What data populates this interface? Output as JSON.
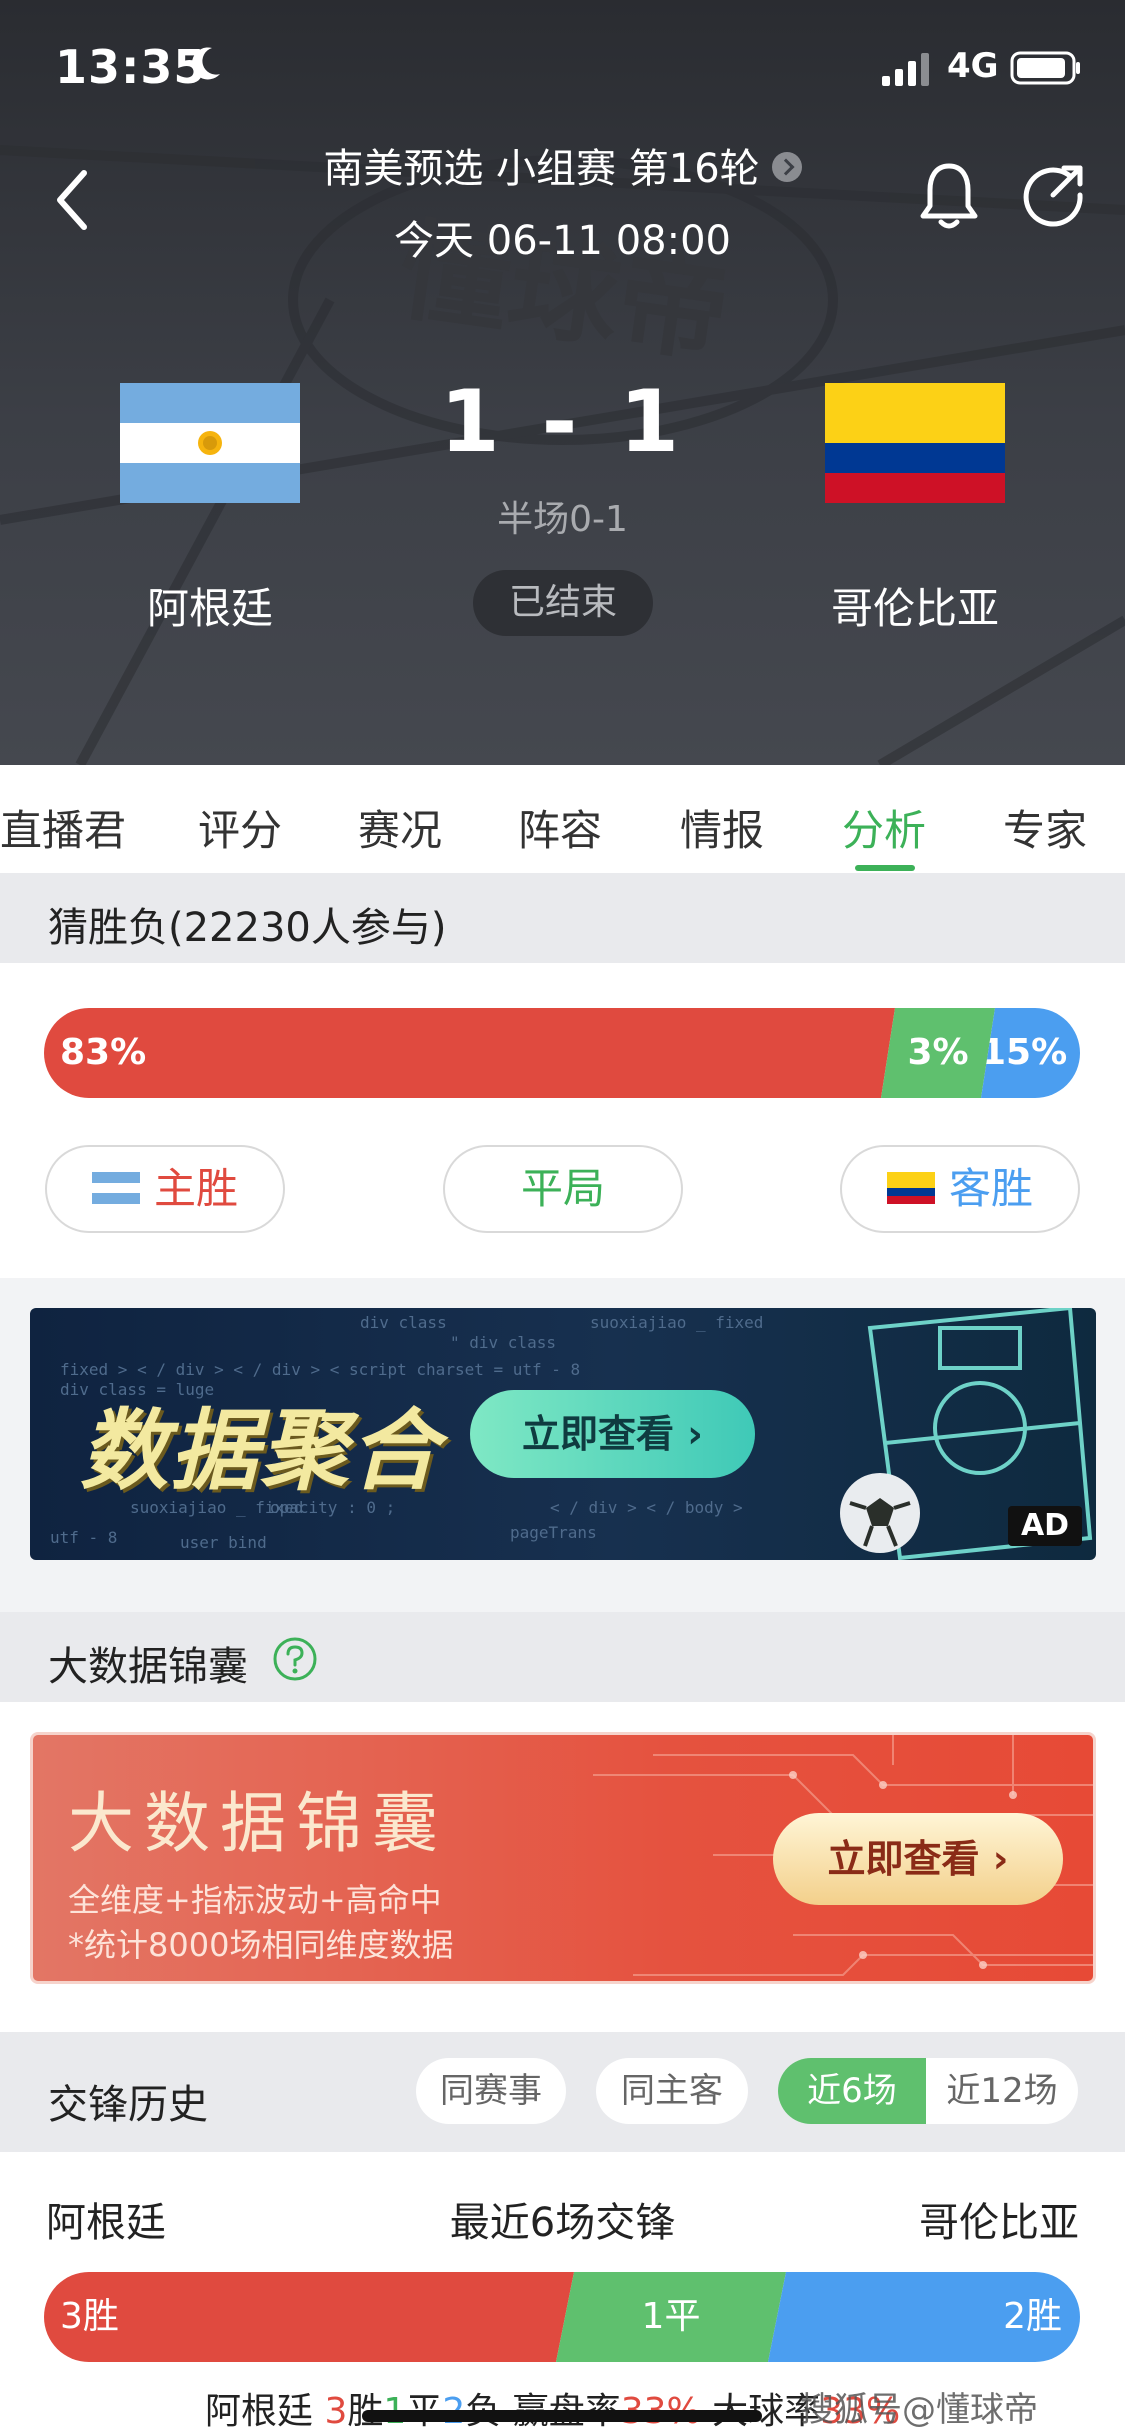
{
  "status_bar": {
    "time": "13:35",
    "network": "4G"
  },
  "header": {
    "match_title": "南美预选 小组赛 第16轮",
    "match_date": "今天 06-11 08:00",
    "score": "1 - 1",
    "halftime": "半场0-1",
    "status": "已结束",
    "home_team": "阿根廷",
    "away_team": "哥伦比亚",
    "watermark_logo": "懂球帝"
  },
  "tabs": [
    {
      "label": "直播君"
    },
    {
      "label": "评分"
    },
    {
      "label": "赛况"
    },
    {
      "label": "阵容"
    },
    {
      "label": "情报"
    },
    {
      "label": "分析",
      "active": true
    },
    {
      "label": "专家"
    }
  ],
  "guess": {
    "heading": "猜胜负(22230人参与)",
    "home_pct_label": "83%",
    "draw_pct_label": "3%",
    "away_pct_label": "15%",
    "home_fraction": 0.83,
    "draw_fraction": 0.03,
    "away_fraction": 0.15,
    "home_btn": "主胜",
    "draw_btn": "平局",
    "away_btn": "客胜"
  },
  "ad": {
    "title": "数据聚合",
    "button": "立即查看 ›",
    "tag": "AD",
    "code_lines": [
      "div class",
      "suoxiajiao _ fixed",
      "fixed  >  <  / div >  <  / div >  < script charset  =  utf  -  8",
      "div class  =  luge",
      "opacity  :  0 ;",
      "\" div class",
      "< / div >  < / body >",
      "pageTrans",
      "utf  -  8",
      "user   bind",
      "suoxiajiao _ fixed"
    ]
  },
  "bigdata": {
    "heading": "大数据锦囊",
    "title": "大数据锦囊",
    "line1": "全维度+指标波动+高命中",
    "line2": "*统计8000场相同维度数据",
    "button": "立即查看 ›"
  },
  "h2h": {
    "heading": "交锋历史",
    "filters": [
      "同赛事",
      "同主客"
    ],
    "seg_active": "近6场",
    "seg_inactive": "近12场",
    "home": "阿根廷",
    "center": "最近6场交锋",
    "away": "哥伦比亚",
    "wins": "3胜",
    "draws": "1平",
    "losses": "2胜"
  },
  "bottom_stats": {
    "team": "阿根廷",
    "w": "3",
    "w_label": "胜",
    "d": "1",
    "d_label": "平",
    "l": "2",
    "l_label": "负",
    "handicap_label": "赢盘率",
    "handicap_val": "33%",
    "over_label": "大球率",
    "over_val": "33%"
  },
  "watermark": "搜狐号@懂球帝",
  "colors": {
    "red": "#e04a3f",
    "green": "#5fc06e",
    "blue": "#4b9ef0",
    "accent": "#3cb158"
  }
}
